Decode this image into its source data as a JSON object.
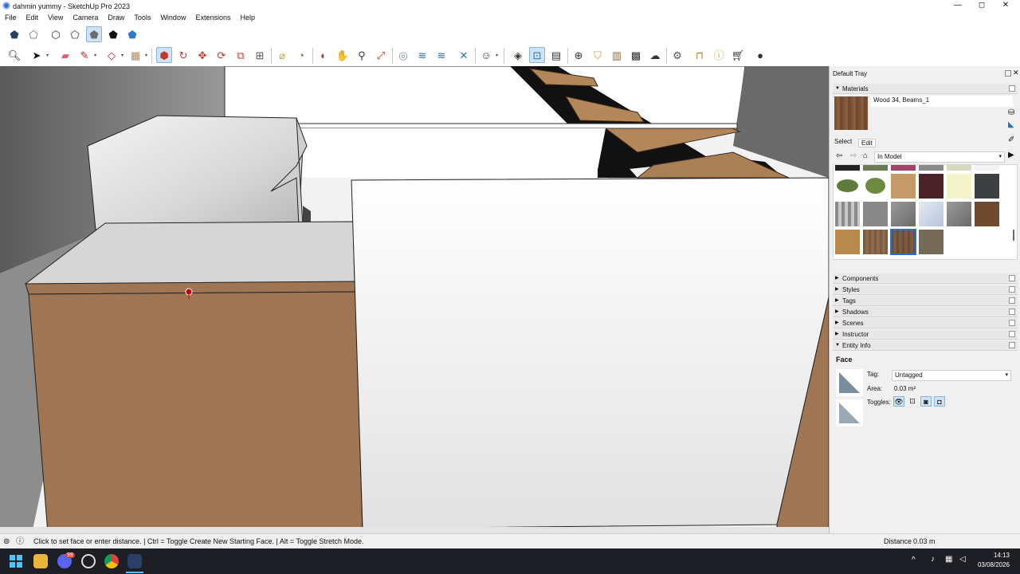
{
  "window": {
    "title": "dahmin yummy - SketchUp Pro 2023",
    "min": "—",
    "max": "◻",
    "close": "✕"
  },
  "menu": [
    "File",
    "Edit",
    "View",
    "Camera",
    "Draw",
    "Tools",
    "Window",
    "Extensions",
    "Help"
  ],
  "tray": {
    "title": "Default Tray",
    "materials": {
      "header": "Materials",
      "current_name": "Wood 34, Beams_1",
      "tab_select": "Select",
      "tab_edit": "Edit",
      "collection": "In Model",
      "swatch_colors": [
        [
          "#222222",
          "#6b7a55",
          "#a0456a",
          "#8a8a8a",
          "#d9d9c0",
          "#f4f4f4"
        ],
        [
          "#5e7a3c",
          "#6e8a40",
          "#c49a68",
          "#4a2228",
          "#f3f3c8",
          "#3e3f40"
        ],
        [
          "#a0a0a0",
          "#888888",
          "#7f7f7f",
          "#d0d8e8",
          "#8a8a8a",
          "#6f4a2e"
        ],
        [
          "#b88a4e",
          "#7b5a40",
          "#6c4d36",
          "#756a58"
        ]
      ]
    },
    "sections": [
      "Components",
      "Styles",
      "Tags",
      "Shadows",
      "Scenes",
      "Instructor",
      "Entity Info"
    ],
    "entity_info": {
      "type": "Face",
      "tag_label": "Tag:",
      "tag_value": "Untagged",
      "area_label": "Area:",
      "area_value": "0.03 m²",
      "toggles_label": "Toggles:"
    }
  },
  "status": {
    "message": "Click to set face or enter distance. | Ctrl = Toggle Create New Starting Face. | Alt = Toggle Stretch Mode.",
    "distance_label": "Distance",
    "distance_value": "0.03 m"
  },
  "taskbar": {
    "time": "14:13",
    "date": "03/08/2026",
    "discord_badge": "99"
  },
  "colors": {
    "wood": "#a07554",
    "selection": "#2a6fd6",
    "accent": "#1e6bd6"
  }
}
